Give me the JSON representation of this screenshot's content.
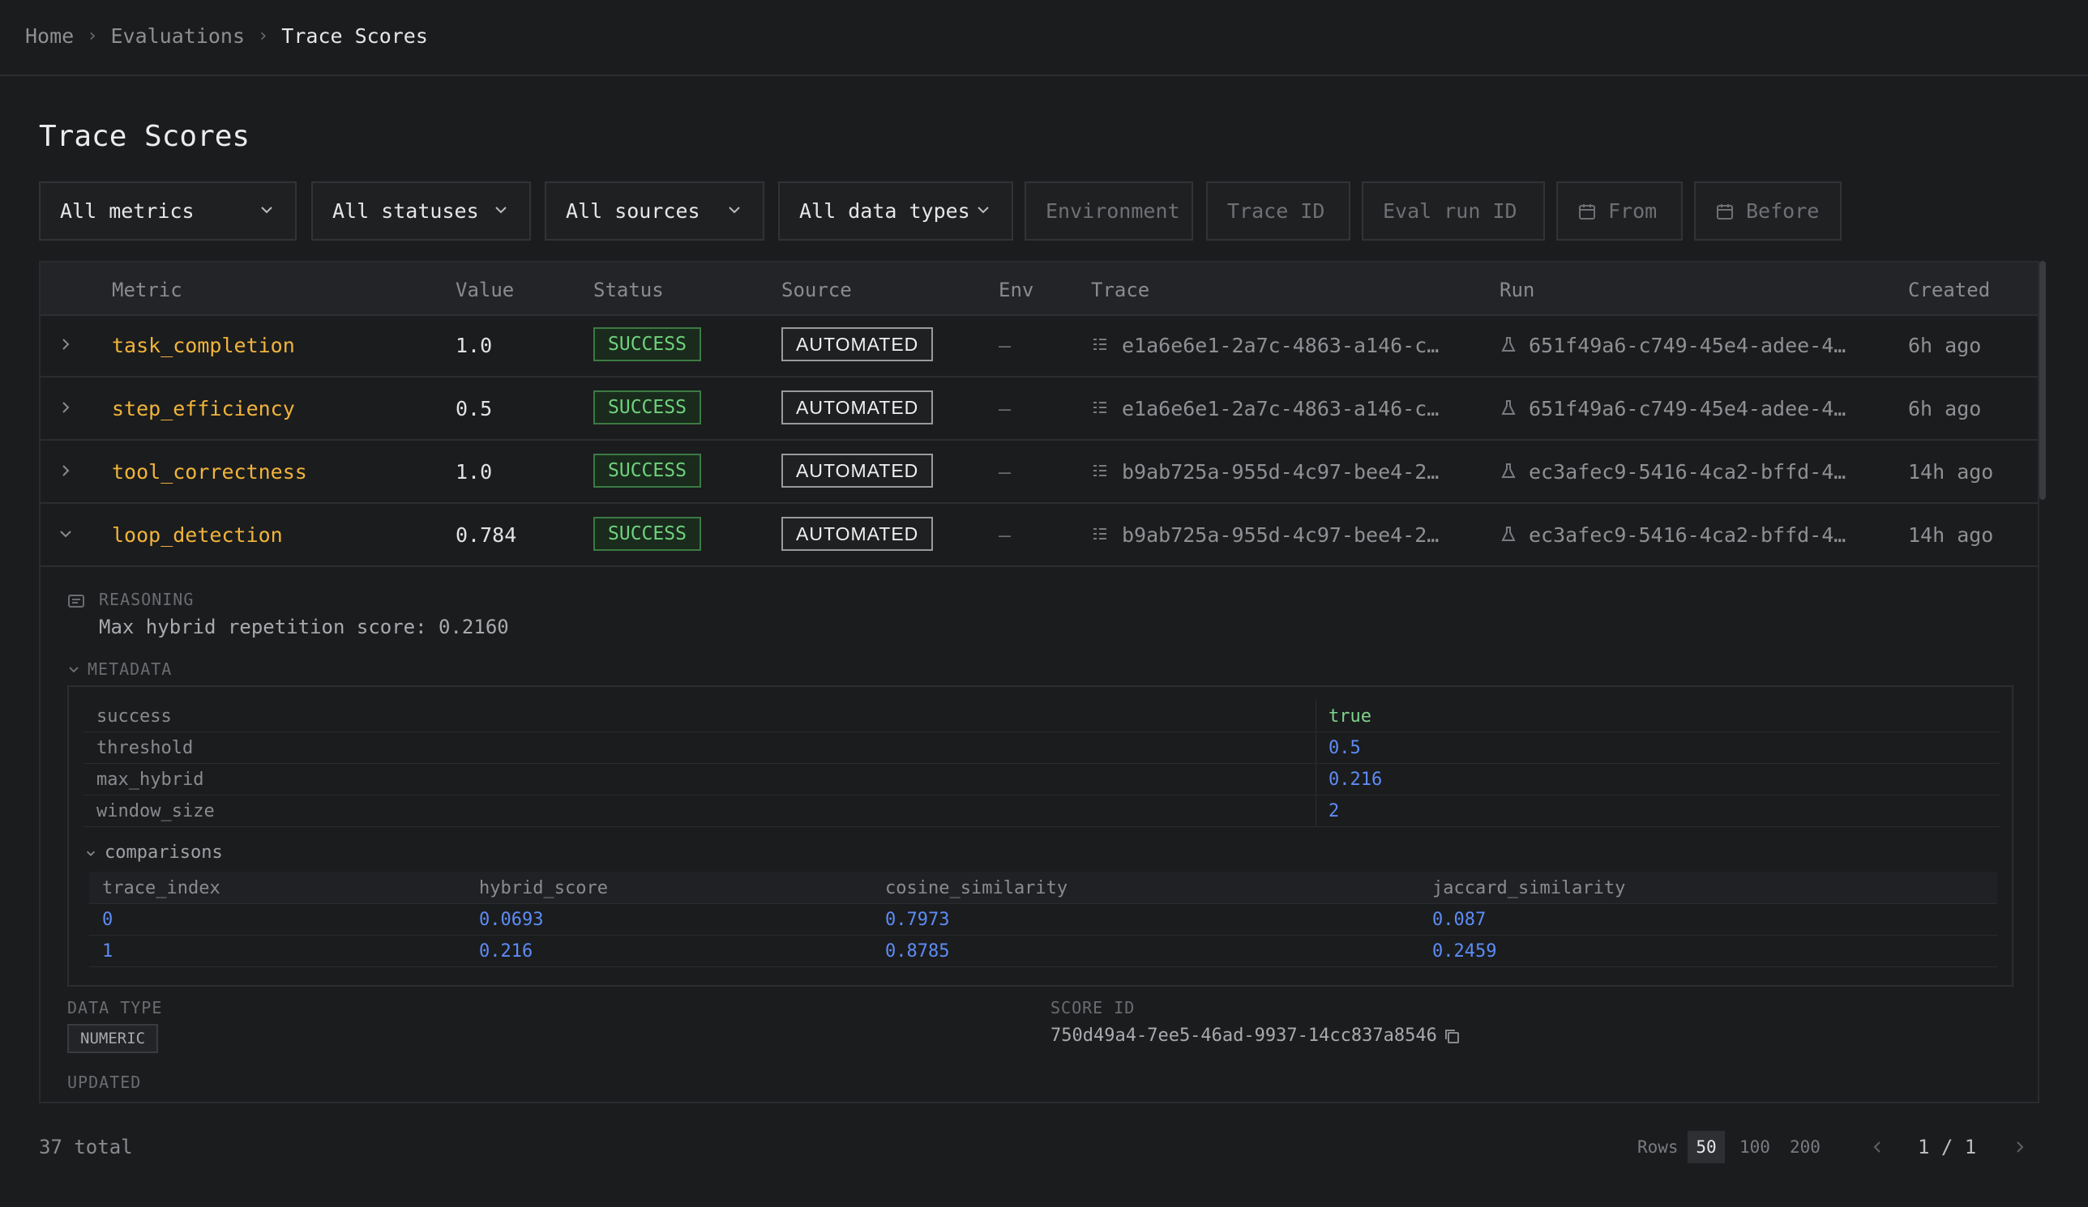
{
  "breadcrumb": {
    "home": "Home",
    "evaluations": "Evaluations",
    "current": "Trace Scores"
  },
  "page": {
    "title": "Trace Scores"
  },
  "filters": {
    "metrics": "All metrics",
    "statuses": "All statuses",
    "sources": "All sources",
    "data_types": "All data types",
    "environment_placeholder": "Environment",
    "trace_id_placeholder": "Trace ID",
    "eval_run_id_placeholder": "Eval run ID",
    "from_placeholder": "From",
    "before_placeholder": "Before"
  },
  "table": {
    "headers": {
      "metric": "Metric",
      "value": "Value",
      "status": "Status",
      "source": "Source",
      "env": "Env",
      "trace": "Trace",
      "run": "Run",
      "created": "Created"
    },
    "rows": [
      {
        "metric": "task_completion",
        "value": "1.0",
        "status": "SUCCESS",
        "source": "AUTOMATED",
        "env": "—",
        "trace": "e1a6e6e1-2a7c-4863-a146-c…",
        "run": "651f49a6-c749-45e4-adee-4…",
        "created": "6h ago",
        "expanded": false
      },
      {
        "metric": "step_efficiency",
        "value": "0.5",
        "status": "SUCCESS",
        "source": "AUTOMATED",
        "env": "—",
        "trace": "e1a6e6e1-2a7c-4863-a146-c…",
        "run": "651f49a6-c749-45e4-adee-4…",
        "created": "6h ago",
        "expanded": false
      },
      {
        "metric": "tool_correctness",
        "value": "1.0",
        "status": "SUCCESS",
        "source": "AUTOMATED",
        "env": "—",
        "trace": "b9ab725a-955d-4c97-bee4-2…",
        "run": "ec3afec9-5416-4ca2-bffd-4…",
        "created": "14h ago",
        "expanded": false
      },
      {
        "metric": "loop_detection",
        "value": "0.784",
        "status": "SUCCESS",
        "source": "AUTOMATED",
        "env": "—",
        "trace": "b9ab725a-955d-4c97-bee4-2…",
        "run": "ec3afec9-5416-4ca2-bffd-4…",
        "created": "14h ago",
        "expanded": true
      }
    ]
  },
  "detail": {
    "reasoning_label": "REASONING",
    "reasoning_text": "Max hybrid repetition score: 0.2160",
    "metadata_label": "METADATA",
    "metadata": [
      {
        "key": "success",
        "value": "true"
      },
      {
        "key": "threshold",
        "value": "0.5"
      },
      {
        "key": "max_hybrid",
        "value": "0.216"
      },
      {
        "key": "window_size",
        "value": "2"
      }
    ],
    "comparisons_label": "comparisons",
    "comparisons_headers": [
      "trace_index",
      "hybrid_score",
      "cosine_similarity",
      "jaccard_similarity"
    ],
    "comparisons_rows": [
      [
        "0",
        "0.0693",
        "0.7973",
        "0.087"
      ],
      [
        "1",
        "0.216",
        "0.8785",
        "0.2459"
      ]
    ],
    "data_type_label": "DATA TYPE",
    "data_type_value": "NUMERIC",
    "score_id_label": "SCORE ID",
    "score_id_value": "750d49a4-7ee5-46ad-9937-14cc837a8546",
    "updated_label": "UPDATED"
  },
  "footer": {
    "total": "37 total",
    "rows_label": "Rows",
    "rows_options": [
      "50",
      "100",
      "200"
    ],
    "rows_selected": "50",
    "page_indicator": "1 / 1"
  },
  "colors": {
    "metric": "#f0b43a",
    "success": "#6fd27d",
    "number": "#5d8cf5",
    "bool": "#7ed38a"
  }
}
